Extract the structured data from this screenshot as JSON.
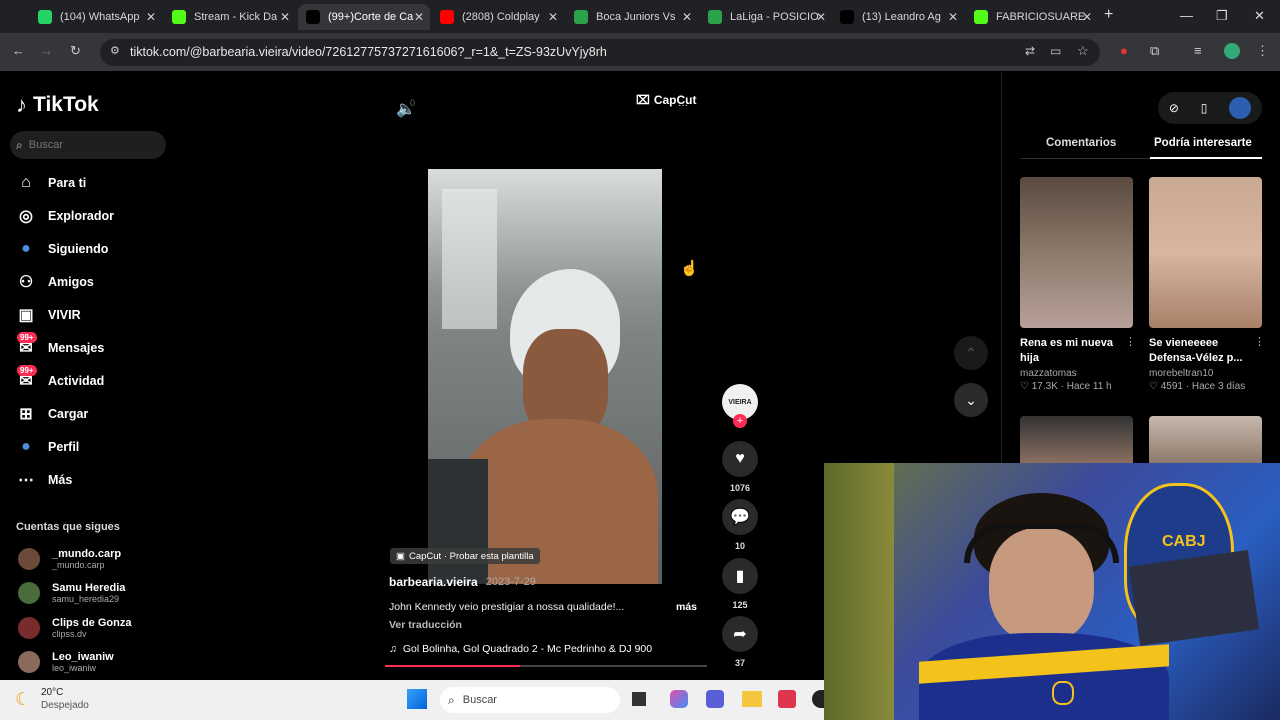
{
  "browser": {
    "tabs": [
      {
        "label": "(104) WhatsApp",
        "color": "#25d366"
      },
      {
        "label": "Stream - Kick Da",
        "color": "#53fc18"
      },
      {
        "label": "(99+)Corte de Ca",
        "color": "#000000"
      },
      {
        "label": "(2808) Coldplay",
        "color": "#ff0000"
      },
      {
        "label": "Boca Juniors Vs",
        "color": "#2ca24b"
      },
      {
        "label": "LaLiga - POSICIO",
        "color": "#2ca24b"
      },
      {
        "label": "(13) Leandro Ag",
        "color": "#000000"
      },
      {
        "label": "FABRICIOSUARE",
        "color": "#53fc18"
      }
    ],
    "url": "tiktok.com/@barbearia.vieira/video/7261277573727161606?_r=1&_t=ZS-93zUvYjy8rh"
  },
  "sidebar": {
    "logo": "TikTok",
    "search_placeholder": "Buscar",
    "nav": [
      {
        "label": "Para ti",
        "icon": "home-icon"
      },
      {
        "label": "Explorador",
        "icon": "compass-icon"
      },
      {
        "label": "Siguiendo",
        "icon": "following-avatar-icon"
      },
      {
        "label": "Amigos",
        "icon": "friends-icon"
      },
      {
        "label": "VIVIR",
        "icon": "live-icon"
      },
      {
        "label": "Mensajes",
        "icon": "messages-icon",
        "badge": "99+"
      },
      {
        "label": "Actividad",
        "icon": "activity-icon",
        "badge": "99+"
      },
      {
        "label": "Cargar",
        "icon": "upload-icon"
      },
      {
        "label": "Perfil",
        "icon": "profile-icon"
      },
      {
        "label": "Más",
        "icon": "more-icon"
      }
    ],
    "follows_title": "Cuentas que sigues",
    "accounts": [
      {
        "name": "_mundo.carp",
        "handle": "_mundo.carp",
        "color": "#6b4a3a"
      },
      {
        "name": "Samu Heredia",
        "handle": "samu_heredia29",
        "color": "#4a6b3a"
      },
      {
        "name": "Clips de Gonza",
        "handle": "clipss.dv",
        "color": "#7a2b2b"
      },
      {
        "name": "Leo_iwaniw",
        "handle": "leo_iwaniw",
        "color": "#8a6a5a"
      }
    ]
  },
  "player": {
    "volume_label": "0",
    "capcut_logo": "CapCut",
    "capcut_tag": "CapCut · Probar esta plantilla",
    "author": "barbearia.vieira",
    "date": "2023-7-29",
    "description": "John Kennedy veio prestigiar a nossa qualidade!...",
    "more": "más",
    "translate": "Ver traducción",
    "music": "Gol Bolinha, Gol Quadrado 2 - Mc Pedrinho & DJ 900",
    "progress": 0.42,
    "avatar_text": "VIEIRA",
    "likes": "1076",
    "comments": "10",
    "saves": "125",
    "shares": "37"
  },
  "right_panel": {
    "tabs": [
      "Comentarios",
      "Podría interesarte"
    ],
    "cards": [
      {
        "title": "Rena es mi nueva hija",
        "author": "mazzatomas",
        "meta": "17.3K · Hace 11 h"
      },
      {
        "title": "Se vieneeeee Defensa-Vélez p...",
        "author": "morebeltran10",
        "meta": "4591 · Hace 3 días"
      }
    ]
  },
  "taskbar": {
    "temp": "20°C",
    "weather": "Despejado",
    "search": "Buscar"
  },
  "webcam": {
    "shirt_text": "CABJ"
  }
}
